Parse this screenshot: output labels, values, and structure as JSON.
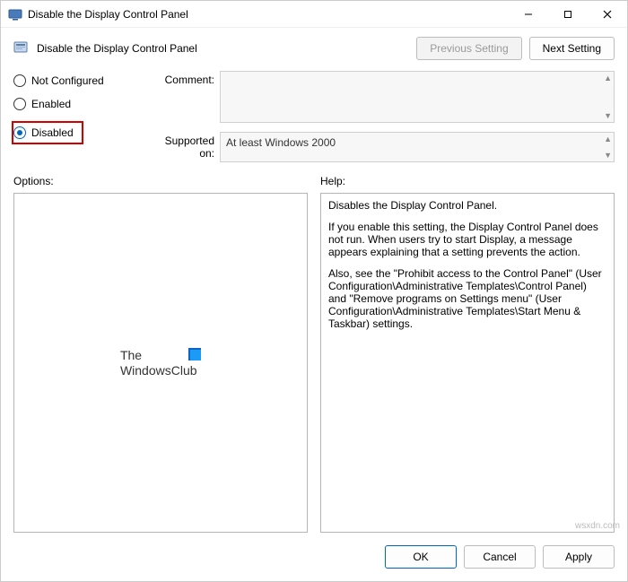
{
  "titlebar": {
    "title": "Disable the Display Control Panel"
  },
  "header": {
    "title": "Disable the Display Control Panel"
  },
  "nav": {
    "previous": "Previous Setting",
    "next": "Next Setting"
  },
  "radios": {
    "not_configured": "Not Configured",
    "enabled": "Enabled",
    "disabled": "Disabled"
  },
  "form": {
    "comment_label": "Comment:",
    "comment_value": "",
    "supported_label": "Supported on:",
    "supported_value": "At least Windows 2000"
  },
  "sections": {
    "options_label": "Options:",
    "help_label": "Help:"
  },
  "brand": {
    "line1": "The",
    "line2": "WindowsClub"
  },
  "help": {
    "p1": "Disables the Display Control Panel.",
    "p2": "If you enable this setting, the Display Control Panel does not run. When users try to start Display, a message appears explaining that a setting prevents the action.",
    "p3": "Also, see the \"Prohibit access to the Control Panel\" (User Configuration\\Administrative Templates\\Control Panel) and \"Remove programs on Settings menu\" (User Configuration\\Administrative Templates\\Start Menu & Taskbar) settings."
  },
  "footer": {
    "ok": "OK",
    "cancel": "Cancel",
    "apply": "Apply"
  },
  "watermark": "wsxdn.com"
}
